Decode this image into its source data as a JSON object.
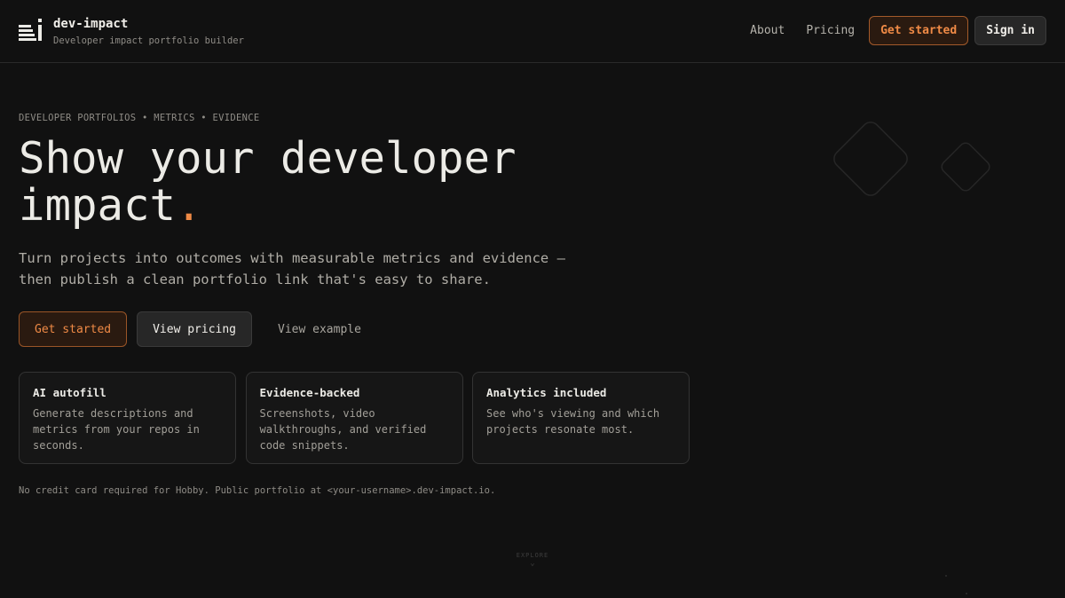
{
  "brand": {
    "name": "dev-impact",
    "tagline": "Developer impact portfolio builder",
    "logo_icon": "stacked-bars-i-logo"
  },
  "nav": {
    "about": "About",
    "pricing": "Pricing",
    "get_started": "Get started",
    "sign_in": "Sign in"
  },
  "hero": {
    "eyebrow": "DEVELOPER PORTFOLIOS • METRICS • EVIDENCE",
    "title_line1": "Show your developer",
    "title_line2": "impact",
    "title_dot": ".",
    "subtitle_line1": "Turn projects into outcomes with measurable metrics and evidence —",
    "subtitle_line2": "then publish a clean portfolio link that's easy to share."
  },
  "cta": {
    "primary": "Get started",
    "secondary": "View pricing",
    "link": "View example"
  },
  "features": [
    {
      "title": "AI autofill",
      "description": "Generate descriptions and metrics from your repos in seconds."
    },
    {
      "title": "Evidence-backed",
      "description": "Screenshots, video walkthroughs, and verified code snippets."
    },
    {
      "title": "Analytics included",
      "description": "See who's viewing and which projects resonate most."
    }
  ],
  "footnote": "No credit card required for Hobby. Public portfolio at <your-username>.dev-impact.io.",
  "explore": {
    "label": "EXPLORE",
    "chevron_icon": "chevron-down-icon"
  },
  "colors": {
    "background": "#111111",
    "accent": "#ef8a46",
    "text": "#ecebe6",
    "muted": "#8f8c86"
  }
}
